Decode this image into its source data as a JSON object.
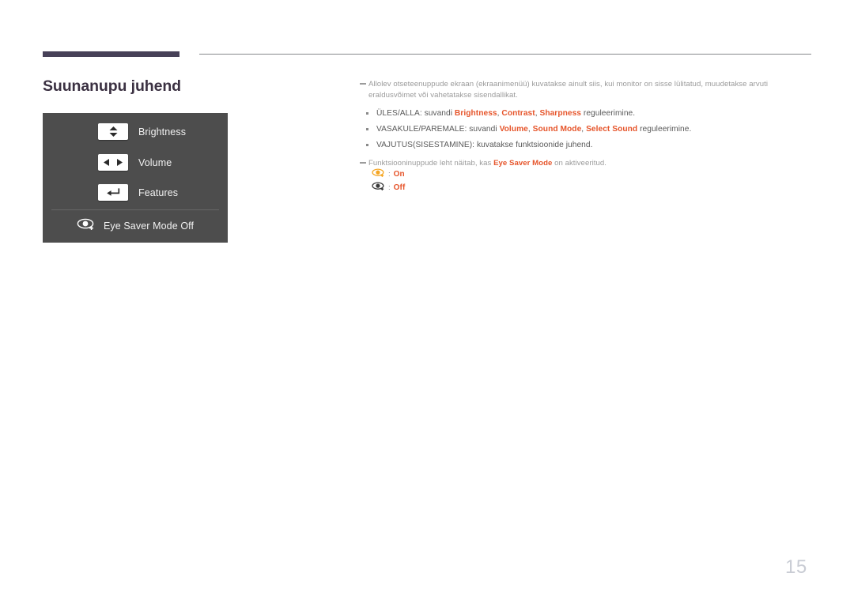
{
  "page": {
    "title": "Suunanupu juhend",
    "number": "15"
  },
  "colors": {
    "rule_thick": "#474158",
    "rule_thin": "#86888c",
    "title": "#3b3142",
    "osd_panel_bg": "#4d4d4d",
    "osd_label": "#f2f2f2",
    "highlight": "#e6552b",
    "note_text": "#9b9b9b",
    "bullet_text": "#595959",
    "page_number": "#c9ccd4",
    "eye_on": "#f5a623",
    "eye_off": "#3a3a3a"
  },
  "osd": {
    "rows": [
      {
        "icon": "up-down-arrows-icon",
        "label": "Brightness"
      },
      {
        "icon": "left-right-arrows-icon",
        "label": "Volume"
      },
      {
        "icon": "enter-return-arrow-icon",
        "label": "Features"
      }
    ],
    "eye_saver": {
      "icon": "eye-saver-mode-icon",
      "label": "Eye Saver Mode Off"
    }
  },
  "notes": {
    "note_1": "Allolev otseteenuppude ekraan (ekraanimenüü) kuvatakse ainult siis, kui monitor on sisse lülitatud, muudetakse arvuti eraldusvõimet või vahetatakse sisendallikat.",
    "note_2_pre": "Funktsioonin",
    "note_2": "Funktsiooninuppude leht näitab, kas ",
    "note_2_hl": "Eye Saver Mode",
    "note_2_post": " on aktiveeritud."
  },
  "bullets": [
    {
      "pre": "ÜLES/ALLA: suvandi ",
      "terms": [
        "Brightness",
        "Contrast",
        "Sharpness"
      ],
      "post": " reguleerimine."
    },
    {
      "pre": "VASAKULE/PAREMALE: suvandi ",
      "terms": [
        "Volume",
        "Sound Mode",
        "Select Sound"
      ],
      "post": " reguleerimine."
    },
    {
      "pre": "VAJUTUS(SISESTAMINE): kuvatakse funktsioonide juhend.",
      "terms": [],
      "post": ""
    }
  ],
  "legend": [
    {
      "icon": "eye-saver-on-icon",
      "separator": ":",
      "label": "On"
    },
    {
      "icon": "eye-saver-off-icon",
      "separator": ":",
      "label": "Off"
    }
  ]
}
